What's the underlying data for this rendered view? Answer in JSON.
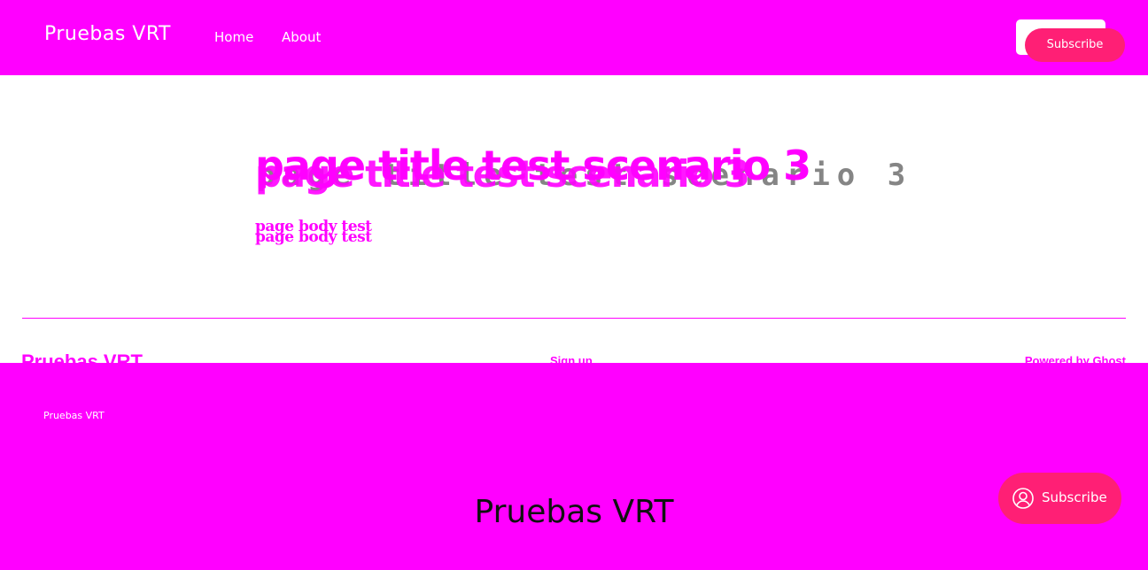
{
  "header": {
    "brand": "Pruebas VRT",
    "nav": [
      "Home",
      "About"
    ],
    "subscribe": "Subscribe"
  },
  "article": {
    "title": "page title test scenario 3",
    "body": "page body test"
  },
  "footer": {
    "brand": "Pruebas VRT",
    "signup": "Sign up",
    "powered_prefix": "Powered by",
    "powered_link": "Ghost"
  },
  "overlay": {
    "small_brand": "Pruebas VRT",
    "big_brand": "Pruebas VRT",
    "portal_label": "Subscribe",
    "portal_icon": "user-circle-icon"
  },
  "colors": {
    "magenta": "#ff00ff",
    "accent": "#ff1f75"
  }
}
